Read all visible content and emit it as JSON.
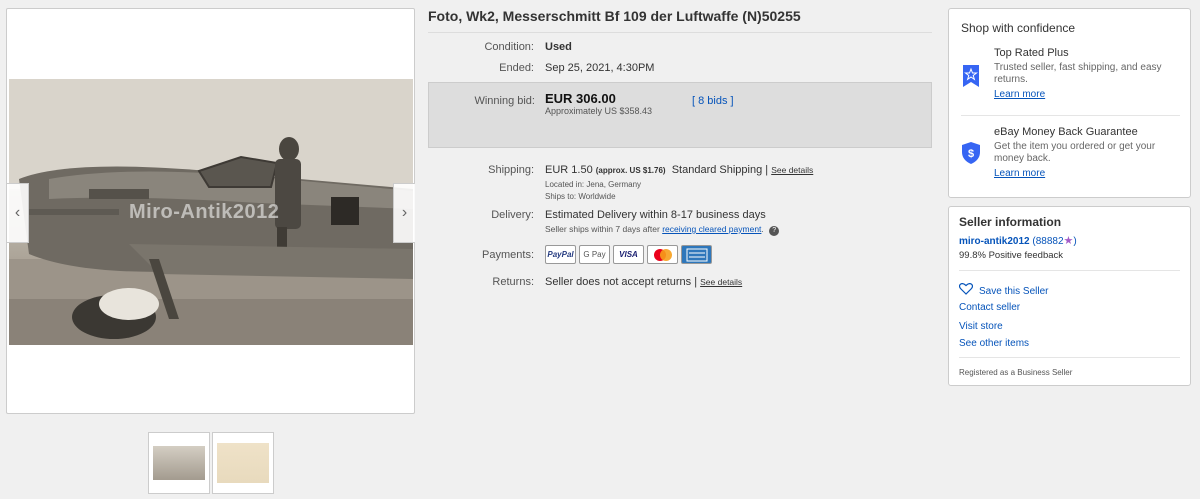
{
  "listing": {
    "title": "Foto, Wk2, Messerschmitt Bf 109 der Luftwaffe (N)50255",
    "watermark": "Miro-Antik2012"
  },
  "details": {
    "condition_label": "Condition:",
    "condition_value": "Used",
    "ended_label": "Ended:",
    "ended_value": "Sep 25, 2021, 4:30PM",
    "winning_label": "Winning bid:",
    "winning_value": "EUR 306.00",
    "approx": "Approximately US $358.43",
    "bids": "[ 8 bids ]",
    "shipping_label": "Shipping:",
    "shipping_value": "EUR 1.50",
    "shipping_approx": "(approx. US $1.76)",
    "shipping_method": "Standard Shipping |",
    "see_details": "See details",
    "located": "Located in:  Jena, Germany",
    "ships_to": "Ships to:   Worldwide",
    "delivery_label": "Delivery:",
    "delivery_value": "Estimated Delivery within 8-17 business days",
    "delivery_note": "Seller ships within 7 days after",
    "delivery_link": "receiving cleared payment",
    "payments_label": "Payments:",
    "payments": [
      "PayPal",
      "G Pay",
      "VISA",
      "MC",
      "AMEX"
    ],
    "returns_label": "Returns:",
    "returns_value": "Seller does not accept returns |",
    "returns_details": "See details"
  },
  "confidence": {
    "title": "Shop with confidence",
    "f1_title": "Top Rated Plus",
    "f1_desc": "Trusted seller, fast shipping, and easy returns.",
    "f1_link": "Learn more",
    "f2_title": "eBay Money Back Guarantee",
    "f2_desc": "Get the item you ordered or get your money back.",
    "f2_link": "Learn more"
  },
  "seller": {
    "title": "Seller information",
    "name": "miro-antik2012",
    "score": "(88882",
    "score_close": ")",
    "feedback": "99.8% Positive feedback",
    "save": "Save this Seller",
    "contact": "Contact seller",
    "visit": "Visit store",
    "other": "See other items",
    "registered": "Registered as a Business Seller"
  },
  "colors": {
    "link": "#0654ba",
    "badge": "#3665f3",
    "star": "#a45dc8"
  },
  "icons": [
    "chevron-left-icon",
    "chevron-right-icon",
    "ribbon-icon",
    "shield-icon",
    "heart-icon",
    "star-icon",
    "info-icon"
  ]
}
